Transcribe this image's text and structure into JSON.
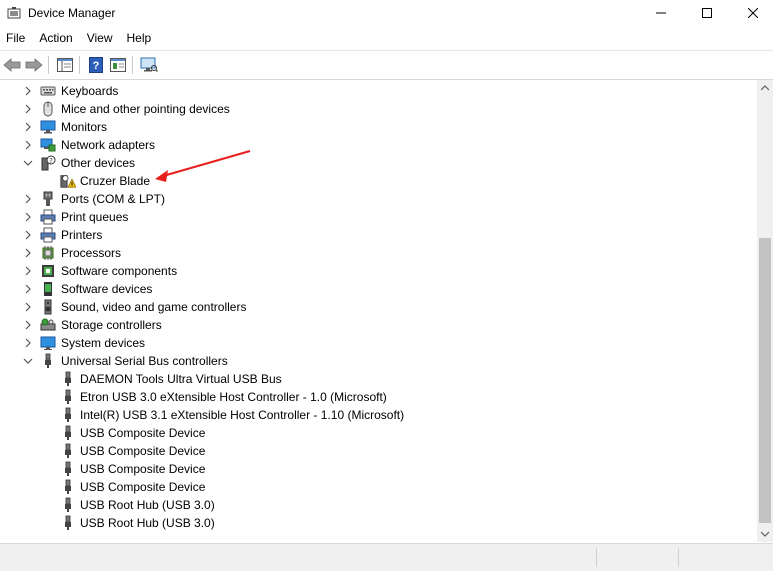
{
  "window": {
    "title": "Device Manager"
  },
  "menu": [
    "File",
    "Action",
    "View",
    "Help"
  ],
  "tree": {
    "items": [
      {
        "label": "Keyboards",
        "icon": "keyboard-icon",
        "expanded": false,
        "level": 0
      },
      {
        "label": "Mice and other pointing devices",
        "icon": "mouse-icon",
        "expanded": false,
        "level": 0
      },
      {
        "label": "Monitors",
        "icon": "monitor-icon",
        "expanded": false,
        "level": 0
      },
      {
        "label": "Network adapters",
        "icon": "network-adapter-icon",
        "expanded": false,
        "level": 0
      },
      {
        "label": "Other devices",
        "icon": "unknown-device-icon",
        "expanded": true,
        "level": 0
      },
      {
        "label": "Cruzer Blade",
        "icon": "warning-device-icon",
        "level": 1
      },
      {
        "label": "Ports (COM & LPT)",
        "icon": "port-icon",
        "expanded": false,
        "level": 0
      },
      {
        "label": "Print queues",
        "icon": "printer-icon",
        "expanded": false,
        "level": 0
      },
      {
        "label": "Printers",
        "icon": "printer-icon",
        "expanded": false,
        "level": 0
      },
      {
        "label": "Processors",
        "icon": "processor-icon",
        "expanded": false,
        "level": 0
      },
      {
        "label": "Software components",
        "icon": "software-component-icon",
        "expanded": false,
        "level": 0
      },
      {
        "label": "Software devices",
        "icon": "software-device-icon",
        "expanded": false,
        "level": 0
      },
      {
        "label": "Sound, video and game controllers",
        "icon": "speaker-icon",
        "expanded": false,
        "level": 0
      },
      {
        "label": "Storage controllers",
        "icon": "storage-controller-icon",
        "expanded": false,
        "level": 0
      },
      {
        "label": "System devices",
        "icon": "system-device-icon",
        "expanded": false,
        "level": 0
      },
      {
        "label": "Universal Serial Bus controllers",
        "icon": "usb-icon",
        "expanded": true,
        "level": 0
      },
      {
        "label": "DAEMON Tools Ultra Virtual USB Bus",
        "icon": "usb-icon",
        "level": 1
      },
      {
        "label": "Etron USB 3.0 eXtensible Host Controller - 1.0 (Microsoft)",
        "icon": "usb-icon",
        "level": 1
      },
      {
        "label": "Intel(R) USB 3.1 eXtensible Host Controller - 1.10 (Microsoft)",
        "icon": "usb-icon",
        "level": 1
      },
      {
        "label": "USB Composite Device",
        "icon": "usb-icon",
        "level": 1
      },
      {
        "label": "USB Composite Device",
        "icon": "usb-icon",
        "level": 1
      },
      {
        "label": "USB Composite Device",
        "icon": "usb-icon",
        "level": 1
      },
      {
        "label": "USB Composite Device",
        "icon": "usb-icon",
        "level": 1
      },
      {
        "label": "USB Root Hub (USB 3.0)",
        "icon": "usb-icon",
        "level": 1
      },
      {
        "label": "USB Root Hub (USB 3.0)",
        "icon": "usb-icon",
        "level": 1
      }
    ]
  },
  "colors": {
    "annotation_arrow": "#e8201c",
    "warning": "#f2c200",
    "accent": "#1e73c8"
  }
}
